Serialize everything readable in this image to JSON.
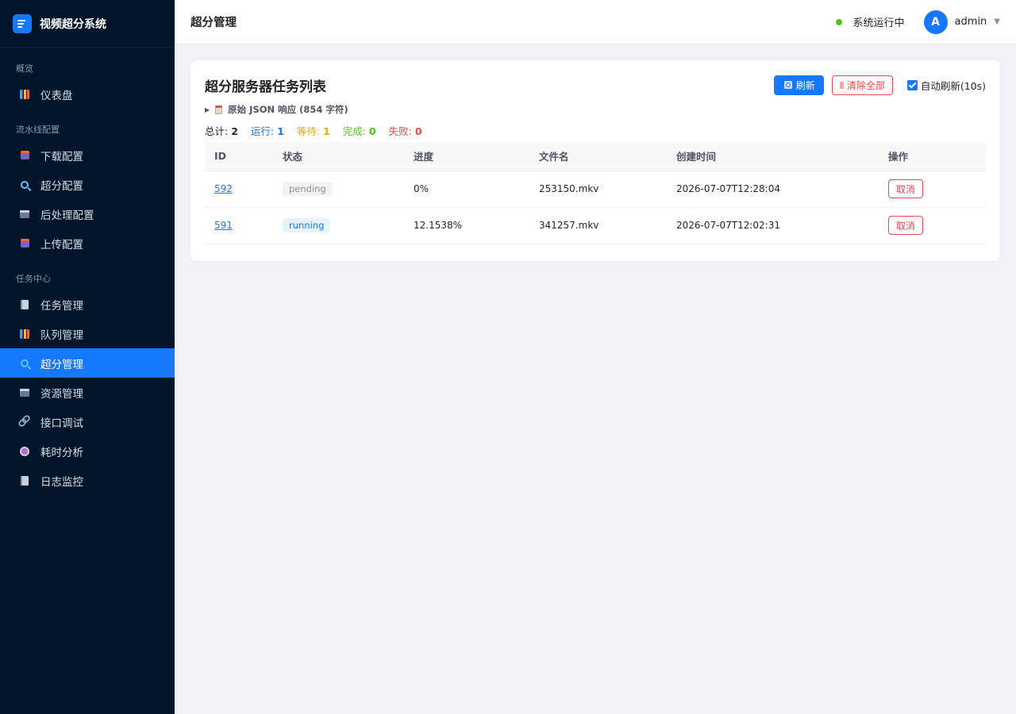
{
  "app": {
    "title": "视频超分系统"
  },
  "sidebar": {
    "groups": [
      {
        "label": "概览"
      },
      {
        "label": "流水线配置"
      },
      {
        "label": "任务中心"
      }
    ],
    "items": [
      {
        "label": "仪表盘",
        "icon": "bar-chart-icon"
      },
      {
        "label": "下载配置",
        "icon": "package-icon"
      },
      {
        "label": "超分配置",
        "icon": "magnifier-icon"
      },
      {
        "label": "后处理配置",
        "icon": "clapper-icon"
      },
      {
        "label": "上传配置",
        "icon": "package-icon"
      },
      {
        "label": "任务管理",
        "icon": "document-icon"
      },
      {
        "label": "队列管理",
        "icon": "bar-chart-icon"
      },
      {
        "label": "超分管理",
        "icon": "magnifier-icon",
        "active": true
      },
      {
        "label": "资源管理",
        "icon": "clapper-icon"
      },
      {
        "label": "接口调试",
        "icon": "link-icon"
      },
      {
        "label": "耗时分析",
        "icon": "clock-icon"
      },
      {
        "label": "日志监控",
        "icon": "document-icon"
      }
    ]
  },
  "header": {
    "title": "超分管理",
    "status": "系统运行中",
    "status_color": "#52c41a",
    "avatar_letter": "A",
    "username": "admin"
  },
  "card": {
    "title": "超分服务器任务列表",
    "refresh_label": "刷新",
    "clear_label": "清除全部",
    "auto_refresh_label": "自动刷新(10s)",
    "json_toggle": "原始 JSON 响应 (854 字符)",
    "stats": {
      "total_label": "总计:",
      "total": "2",
      "running_label": "运行:",
      "running": "1",
      "waiting_label": "等待:",
      "waiting": "1",
      "done_label": "完成:",
      "done": "0",
      "failed_label": "失败:",
      "failed": "0"
    },
    "table": {
      "columns": [
        "ID",
        "状态",
        "进度",
        "文件名",
        "创建时间",
        "操作"
      ],
      "rows": [
        {
          "id": "592",
          "status": "pending",
          "progress": "0%",
          "filename": "253150.mkv",
          "created": "2026-07-07T12:28:04",
          "action": "取消"
        },
        {
          "id": "591",
          "status": "running",
          "progress": "12.1538%",
          "filename": "341257.mkv",
          "created": "2026-07-07T12:02:31",
          "action": "取消"
        }
      ]
    }
  },
  "colors": {
    "primary": "#1677ff",
    "danger": "#e5484d",
    "sidebar_bg": "#001529"
  }
}
